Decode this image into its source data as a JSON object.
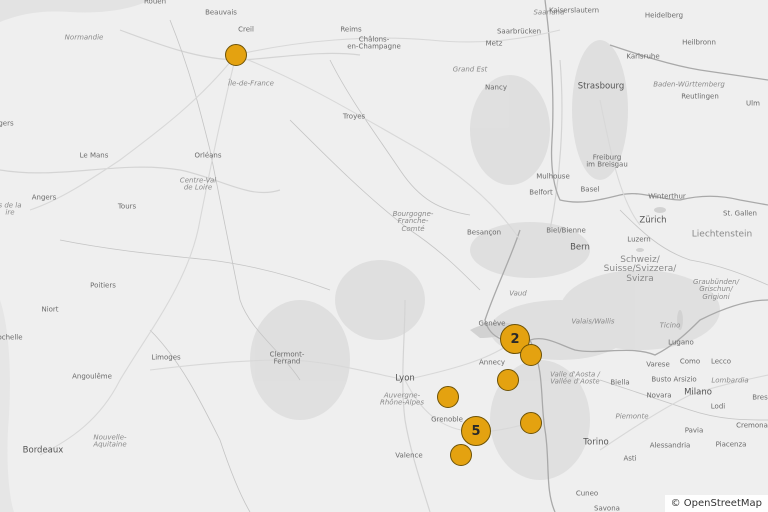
{
  "map": {
    "attribution": "© OpenStreetMap",
    "colors": {
      "marker_fill": "#e4a210",
      "marker_stroke": "#6d5206",
      "background": "#efefef"
    },
    "labels": [
      {
        "text": "Rouen",
        "kind": "city"
      },
      {
        "text": "Beauvais",
        "kind": "city"
      },
      {
        "text": "Creil",
        "kind": "city"
      },
      {
        "text": "Normandie",
        "kind": "region"
      },
      {
        "text": "Île-de-France",
        "kind": "region"
      },
      {
        "text": "Reims",
        "kind": "city"
      },
      {
        "text": "Châlons-\nen-Champagne",
        "kind": "city"
      },
      {
        "text": "Metz",
        "kind": "city"
      },
      {
        "text": "Grand Est",
        "kind": "region"
      },
      {
        "text": "Nancy",
        "kind": "city"
      },
      {
        "text": "Troyes",
        "kind": "city"
      },
      {
        "text": "Saarland",
        "kind": "region"
      },
      {
        "text": "Kaiserslautern",
        "kind": "city"
      },
      {
        "text": "Heidelberg",
        "kind": "city"
      },
      {
        "text": "Saarbrücken",
        "kind": "city"
      },
      {
        "text": "Heilbronn",
        "kind": "city"
      },
      {
        "text": "Karlsruhe",
        "kind": "city"
      },
      {
        "text": "Strasbourg",
        "kind": "city-big"
      },
      {
        "text": "Baden-Württemberg",
        "kind": "region"
      },
      {
        "text": "Reutlingen",
        "kind": "city"
      },
      {
        "text": "Ulm",
        "kind": "city"
      },
      {
        "text": "Freiburg\nim Breisgau",
        "kind": "city"
      },
      {
        "text": "Mulhouse",
        "kind": "city"
      },
      {
        "text": "Basel",
        "kind": "city"
      },
      {
        "text": "Zürich",
        "kind": "city-big"
      },
      {
        "text": "Winterthur",
        "kind": "city"
      },
      {
        "text": "St. Gallen",
        "kind": "city"
      },
      {
        "text": "Liechtenstein",
        "kind": "country"
      },
      {
        "text": "Belfort",
        "kind": "city"
      },
      {
        "text": "Biel/Bienne",
        "kind": "city"
      },
      {
        "text": "Bern",
        "kind": "city-big"
      },
      {
        "text": "Luzern",
        "kind": "city"
      },
      {
        "text": "Schweiz/\nSuisse/Svizzera/\nSvizra",
        "kind": "country"
      },
      {
        "text": "Graubünden/\nGrischun/\nGrigioni",
        "kind": "region"
      },
      {
        "text": "Bourgogne-\nFranche-\nComté",
        "kind": "region"
      },
      {
        "text": "Besançon",
        "kind": "city"
      },
      {
        "text": "Vaud",
        "kind": "region"
      },
      {
        "text": "Valais/Wallis",
        "kind": "region"
      },
      {
        "text": "Ticino",
        "kind": "region"
      },
      {
        "text": "Genève",
        "kind": "city"
      },
      {
        "text": "Annecy",
        "kind": "city"
      },
      {
        "text": "Lugano",
        "kind": "city"
      },
      {
        "text": "Como",
        "kind": "city"
      },
      {
        "text": "Lecco",
        "kind": "city"
      },
      {
        "text": "Varese",
        "kind": "city"
      },
      {
        "text": "Valle d'Aosta /\nVallée d'Aoste",
        "kind": "region"
      },
      {
        "text": "Biella",
        "kind": "city"
      },
      {
        "text": "Busto Arsizio",
        "kind": "city"
      },
      {
        "text": "Lombardia",
        "kind": "region"
      },
      {
        "text": "Milano",
        "kind": "city-big"
      },
      {
        "text": "Novara",
        "kind": "city"
      },
      {
        "text": "Lodi",
        "kind": "city"
      },
      {
        "text": "Bres",
        "kind": "city"
      },
      {
        "text": "Cremona",
        "kind": "city"
      },
      {
        "text": "Pavia",
        "kind": "city"
      },
      {
        "text": "Piacenza",
        "kind": "city"
      },
      {
        "text": "Piemonte",
        "kind": "region"
      },
      {
        "text": "Alessandria",
        "kind": "city"
      },
      {
        "text": "Torino",
        "kind": "city-big"
      },
      {
        "text": "Asti",
        "kind": "city"
      },
      {
        "text": "Cuneo",
        "kind": "city"
      },
      {
        "text": "Savona",
        "kind": "city"
      },
      {
        "text": "Lyon",
        "kind": "city-big"
      },
      {
        "text": "Auvergne-\nRhône-Alpes",
        "kind": "region"
      },
      {
        "text": "Grenoble",
        "kind": "city"
      },
      {
        "text": "Valence",
        "kind": "city"
      },
      {
        "text": "Clermont-\nFerrand",
        "kind": "city"
      },
      {
        "text": "Limoges",
        "kind": "city"
      },
      {
        "text": "Angoulême",
        "kind": "city"
      },
      {
        "text": "Nouvelle-\nAquitaine",
        "kind": "region"
      },
      {
        "text": "Bordeaux",
        "kind": "city-big"
      },
      {
        "text": "Poitiers",
        "kind": "city"
      },
      {
        "text": "Niort",
        "kind": "city"
      },
      {
        "text": "ochelle",
        "kind": "city"
      },
      {
        "text": "Tours",
        "kind": "city"
      },
      {
        "text": "Angers",
        "kind": "city"
      },
      {
        "text": "s de la\nire",
        "kind": "region"
      },
      {
        "text": "Le Mans",
        "kind": "city"
      },
      {
        "text": "Orléans",
        "kind": "city"
      },
      {
        "text": "Centre-Val\nde Loire",
        "kind": "region"
      },
      {
        "text": "gers",
        "kind": "city"
      }
    ],
    "markers": [
      {
        "id": "marker-paris",
        "count": ""
      },
      {
        "id": "marker-geneva-cluster",
        "count": "2"
      },
      {
        "id": "marker-chamonix",
        "count": ""
      },
      {
        "id": "marker-albertville",
        "count": ""
      },
      {
        "id": "marker-chambery",
        "count": ""
      },
      {
        "id": "marker-grenoble-cluster",
        "count": "5"
      },
      {
        "id": "marker-briancon",
        "count": ""
      },
      {
        "id": "marker-vercors",
        "count": ""
      }
    ]
  }
}
